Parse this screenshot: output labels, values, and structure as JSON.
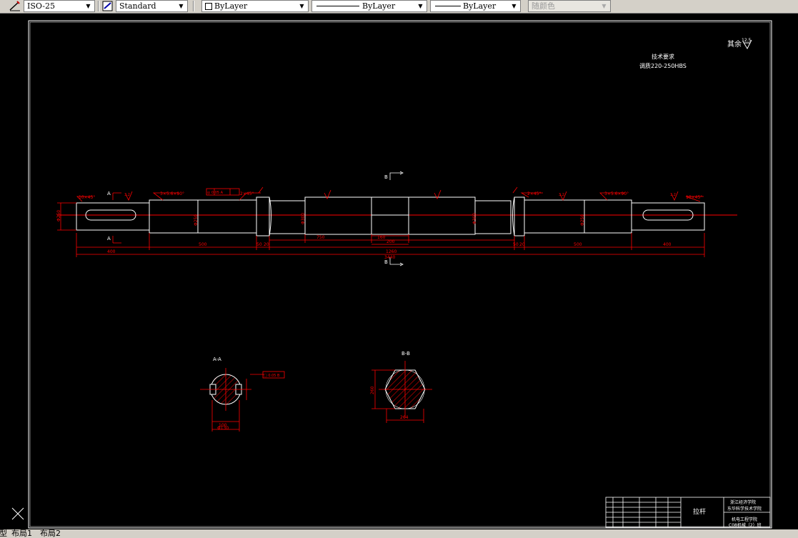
{
  "toolbar": {
    "dimstyle": "ISO-25",
    "textstyle": "Standard",
    "layer": "ByLayer",
    "linetype": "ByLayer",
    "lineweight": "ByLayer",
    "color": "随颜色"
  },
  "drawing": {
    "tech_req_title": "技术要求",
    "tech_req_line": "调质220-250HBS",
    "roughness_remaining": "其余",
    "roughness_value": "12.5",
    "section_a_label": "A",
    "section_b_label": "B",
    "section_aa_title": "A-A",
    "section_bb_title": "B-B",
    "dims": {
      "overall": "3440",
      "left_key_len": "400",
      "left_body_len": "500",
      "center_mid": "1260",
      "center_left": "750",
      "center_small": "160",
      "center_sub": "200",
      "right_body_len": "500",
      "right_key_len": "400",
      "small_left_a": "50",
      "small_left_b": "20",
      "small_right_a": "50",
      "small_right_b": "20",
      "chamfer_left": "10×45°",
      "chamfer_right": "10×45°",
      "chamfer_mid_left": "2×45°",
      "chamfer_mid_right": "2×45°",
      "groove_left": "3×5.6×90°",
      "groove_right": "3×5.6×90°",
      "phi_left": "Φ250",
      "phi_center": "Φ300",
      "phi_right": "Φ250",
      "phi_end": "Φ250",
      "phi_center2": "Φ300",
      "tol_frame": "◎ 0.05 A",
      "key_width": "100",
      "key_depth": "Φ130",
      "sec_a_tol": "□ 0.05 B",
      "sec_b_hex": "260",
      "sec_b_width": "264",
      "rough_values": [
        "3.2",
        "3.2",
        "3.2",
        "3.2",
        "3.2",
        "3.2"
      ]
    },
    "title_block": {
      "part_name": "拉杆",
      "school_1": "浙江经济学院",
      "school_2": "东华科学技术学院",
      "dept": "机电工程学院",
      "class_name": "C08机械（2）班"
    }
  },
  "layout_tabs": [
    "模型",
    "布局1",
    "布局2"
  ]
}
